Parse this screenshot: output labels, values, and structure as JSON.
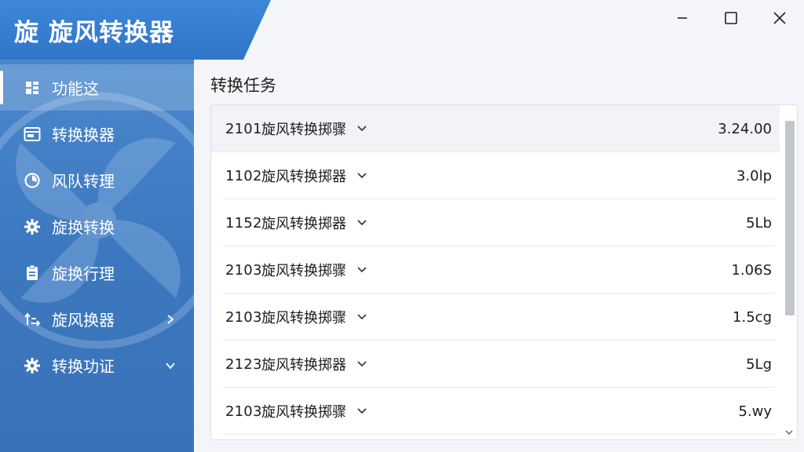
{
  "app": {
    "logo_glyph": "旋",
    "title": "旋风转换器"
  },
  "window_controls": {
    "minimize_icon": "minimize-icon",
    "maximize_icon": "maximize-icon",
    "close_icon": "close-icon"
  },
  "sidebar": {
    "items": [
      {
        "label": "功能这",
        "icon": "grid-icon",
        "active": true,
        "chevron": ""
      },
      {
        "label": "转换换器",
        "icon": "window-icon",
        "active": false,
        "chevron": ""
      },
      {
        "label": "风队转理",
        "icon": "clock-icon",
        "active": false,
        "chevron": ""
      },
      {
        "label": "旋换转换",
        "icon": "gear-icon",
        "active": false,
        "chevron": ""
      },
      {
        "label": "旋换行理",
        "icon": "clipboard-icon",
        "active": false,
        "chevron": ""
      },
      {
        "label": "旋风换器",
        "icon": "transfer-icon",
        "active": false,
        "chevron": "right"
      },
      {
        "label": "转换功证",
        "icon": "gear-icon",
        "active": false,
        "chevron": "down"
      }
    ]
  },
  "main": {
    "section_title": "转换任务",
    "tasks": [
      {
        "id": "2101",
        "name": "旋风转换掷骤",
        "value": "3.24.00"
      },
      {
        "id": "1102",
        "name": "旋风转换掷器",
        "value": "3.0lp"
      },
      {
        "id": "1152",
        "name": "旋风转换掷器",
        "value": "5Lb"
      },
      {
        "id": "2103",
        "name": "旋风转换掷骤",
        "value": "1.06S"
      },
      {
        "id": "2103",
        "name": "旋风转换掷骤",
        "value": "1.5cg"
      },
      {
        "id": "2123",
        "name": "旋风转换掷器",
        "value": "5Lg"
      },
      {
        "id": "2103",
        "name": "旋风转换掷骤",
        "value": "5.wy"
      }
    ]
  },
  "colors": {
    "brand": "#3d86d8",
    "sidebar": "#4a87cc",
    "accent_white": "#ffffff"
  }
}
